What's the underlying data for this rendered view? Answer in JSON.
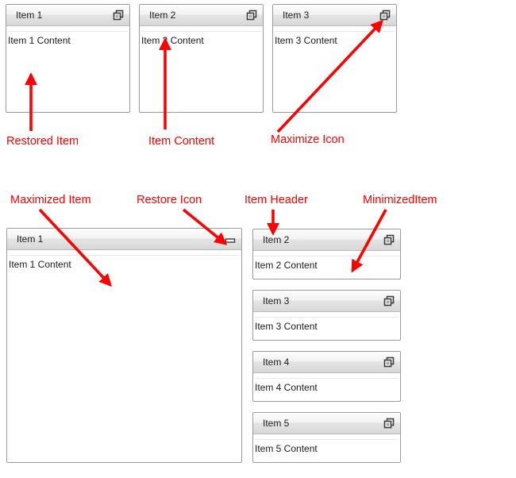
{
  "colors": {
    "annotation": "#ff0000",
    "panel_border": "#9a9a9a",
    "header_top": "#fcfcfc",
    "header_bottom": "#d8d8d8",
    "text": "#1b1b1b"
  },
  "restored_row": {
    "panels": [
      {
        "title": "Item 1",
        "content": "Item 1 Content",
        "button": "maximize-icon"
      },
      {
        "title": "Item 2",
        "content": "Item 2 Content",
        "button": "maximize-icon"
      },
      {
        "title": "Item 3",
        "content": "Item 3 Content",
        "button": "maximize-icon"
      }
    ]
  },
  "maximized_panel": {
    "title": "Item 1",
    "content": "Item 1 Content",
    "button": "restore-icon"
  },
  "minimized_column": {
    "panels": [
      {
        "title": "Item 2",
        "content": "Item 2 Content",
        "button": "maximize-icon"
      },
      {
        "title": "Item 3",
        "content": "Item 3 Content",
        "button": "maximize-icon"
      },
      {
        "title": "Item 4",
        "content": "Item 4 Content",
        "button": "maximize-icon"
      },
      {
        "title": "Item 5",
        "content": "Item 5 Content",
        "button": "maximize-icon"
      }
    ]
  },
  "annotations": {
    "restored_item": "Restored Item",
    "item_content": "Item Content",
    "maximize_icon": "Maximize Icon",
    "maximized_item": "Maximized Item",
    "restore_icon": "Restore Icon",
    "item_header": "Item Header",
    "minimized_item": "MinimizedItem"
  }
}
